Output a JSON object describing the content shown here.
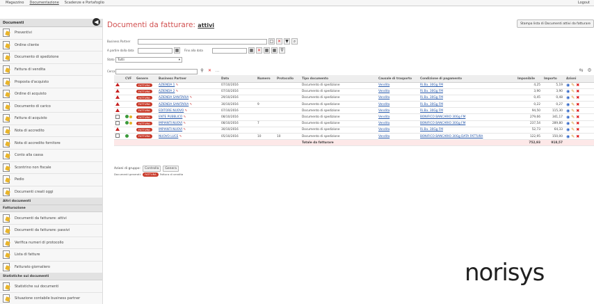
{
  "topbar": {
    "menus": [
      "Magazzino",
      "Documentazione",
      "Scadenze e Portafoglio"
    ],
    "logout": "Logout"
  },
  "sidebar": {
    "header": "Documenti",
    "items": [
      {
        "label": "Preventivi",
        "icon": "document-icon"
      },
      {
        "label": "Ordine cliente",
        "icon": "document-icon"
      },
      {
        "label": "Documento di spedizione",
        "icon": "document-icon"
      },
      {
        "label": "Fattura di vendita",
        "icon": "document-icon"
      },
      {
        "label": "Proposta d'acquisto",
        "icon": "document-icon"
      },
      {
        "label": "Ordine di acquisto",
        "icon": "document-icon"
      },
      {
        "label": "Documento di carico",
        "icon": "document-icon"
      },
      {
        "label": "Fattura di acquisto",
        "icon": "document-icon"
      },
      {
        "label": "Nota di accredito",
        "icon": "document-icon"
      },
      {
        "label": "Nota di accredito fornitore",
        "icon": "document-icon"
      },
      {
        "label": "Conto alla cassa",
        "icon": "document-icon"
      },
      {
        "label": "Scontrino non fiscale",
        "icon": "document-icon"
      },
      {
        "label": "Pedio",
        "icon": "document-icon"
      },
      {
        "label": "Documenti creati oggi",
        "icon": "document-icon"
      }
    ],
    "section_more": "Altri documenti",
    "section_invoicing": "Fatturazione",
    "invoicing_items": [
      {
        "label": "Documenti da fatturare: attivi",
        "icon": "document-icon"
      },
      {
        "label": "Documenti da fatturare: passivi",
        "icon": "document-icon"
      },
      {
        "label": "Verifica numeri di protocollo",
        "icon": "document-icon"
      },
      {
        "label": "Lista di fatture",
        "icon": "document-icon"
      },
      {
        "label": "Fatturato giornaliero",
        "icon": "document-icon"
      }
    ],
    "section_stats": "Statistiche sui documenti",
    "stats_items": [
      {
        "label": "Statistiche sui documenti",
        "icon": "document-icon"
      },
      {
        "label": "Situazione contabile business partner",
        "icon": "document-icon"
      }
    ]
  },
  "main": {
    "title": "Documenti da fatturare:",
    "title_suffix": "attivi",
    "print_button": "Stampa lista di Documenti attivi da fatturare",
    "filters": {
      "partner_label": "Business Partner",
      "date_from_label": "A partire dalla data",
      "date_to_label": "Fino alla data",
      "state_label": "Stato",
      "state_value": "Tutti",
      "search_label": "Cerca"
    },
    "table": {
      "headers": [
        "",
        "CVF",
        "Genere",
        "Business Partner",
        "Data",
        "Numero",
        "Protocollo",
        "Tipo documento",
        "Causale di trasporto",
        "Condizione di pagamento",
        "Imponibile",
        "Importo",
        "Azioni"
      ],
      "rows": [
        {
          "badge": "FATTURA",
          "partner": "AZIENDA 1",
          "date": "07/10/2016",
          "number": "",
          "protocol": "",
          "type": "Documento di spedizione",
          "transport": "Vendita",
          "payment": "Ri.Ba. 30Gg FM",
          "taxable": "4,25",
          "amount": "5,19"
        },
        {
          "badge": "FATTURA",
          "partner": "AZIENDA 2",
          "date": "07/10/2016",
          "number": "",
          "protocol": "",
          "type": "Documento di spedizione",
          "transport": "Vendita",
          "payment": "Ri.Ba. 30Gg FM",
          "taxable": "3,90",
          "amount": "3,90"
        },
        {
          "badge": "FATTURA",
          "partner": "AZIENDA SANITARIA",
          "date": "29/10/2016",
          "number": "",
          "protocol": "",
          "type": "Documento di spedizione",
          "transport": "Vendita",
          "payment": "Ri.Ba. 30Gg FM",
          "taxable": "0,45",
          "amount": "0,48"
        },
        {
          "badge": "FATTURA",
          "partner": "AZIENDA SANITARIA",
          "date": "30/10/2016",
          "number": "9",
          "protocol": "",
          "type": "Documento di spedizione",
          "transport": "Vendita",
          "payment": "Ri.Ba. 30Gg FM",
          "taxable": "0,22",
          "amount": "0,27"
        },
        {
          "badge": "FATTURA",
          "partner": "EDITORE NUOVO",
          "date": "07/10/2016",
          "number": "",
          "protocol": "",
          "type": "Documento di spedizione",
          "transport": "Vendita",
          "payment": "Ri.Ba. 30Gg FM",
          "taxable": "94,50",
          "amount": "115,30"
        },
        {
          "badge": "FATTURA",
          "partner": "ENTE PUBBLICO",
          "date": "08/10/2016",
          "number": "",
          "protocol": "",
          "type": "Documento di spedizione",
          "transport": "Vendita",
          "payment": "BONIFICO BANCARIO 30Gg FM",
          "taxable": "279,66",
          "amount": "341,17"
        },
        {
          "badge": "FATTURA",
          "partner": "IMPIANTI NUOVI",
          "date": "08/10/2016",
          "number": "7",
          "protocol": "",
          "type": "Documento di spedizione",
          "transport": "Vendita",
          "payment": "BONIFICO BANCARIO 30Gg FM",
          "taxable": "237,54",
          "amount": "289,80"
        },
        {
          "badge": "FATTURA",
          "partner": "IMPIANTI NUOVI",
          "date": "30/10/2016",
          "number": "",
          "protocol": "",
          "type": "Documento di spedizione",
          "transport": "Vendita",
          "payment": "Ri.Ba. 30Gg FM",
          "taxable": "52,73",
          "amount": "64,33"
        },
        {
          "badge": "FATTURA",
          "partner": "NUOVO LUCE",
          "date": "05/10/2016",
          "number": "10",
          "protocol": "10",
          "type": "Documento di spedizione",
          "transport": "Vendita",
          "payment": "BONIFICO BANCARIO 30Gg DATA FATTURA",
          "taxable": "122,95",
          "amount": "150,00"
        }
      ],
      "total_label": "Totale da fatturare",
      "total_taxable": "752,93",
      "total_amount": "918,57"
    },
    "group_actions_label": "Azioni di gruppo:",
    "group_buttons": [
      "Controlla",
      "Genera"
    ],
    "legend_label": "Documenti generati:",
    "legend_badge": "FATTURA",
    "legend_text": "Fattura di vendita"
  },
  "logo": "norisys"
}
